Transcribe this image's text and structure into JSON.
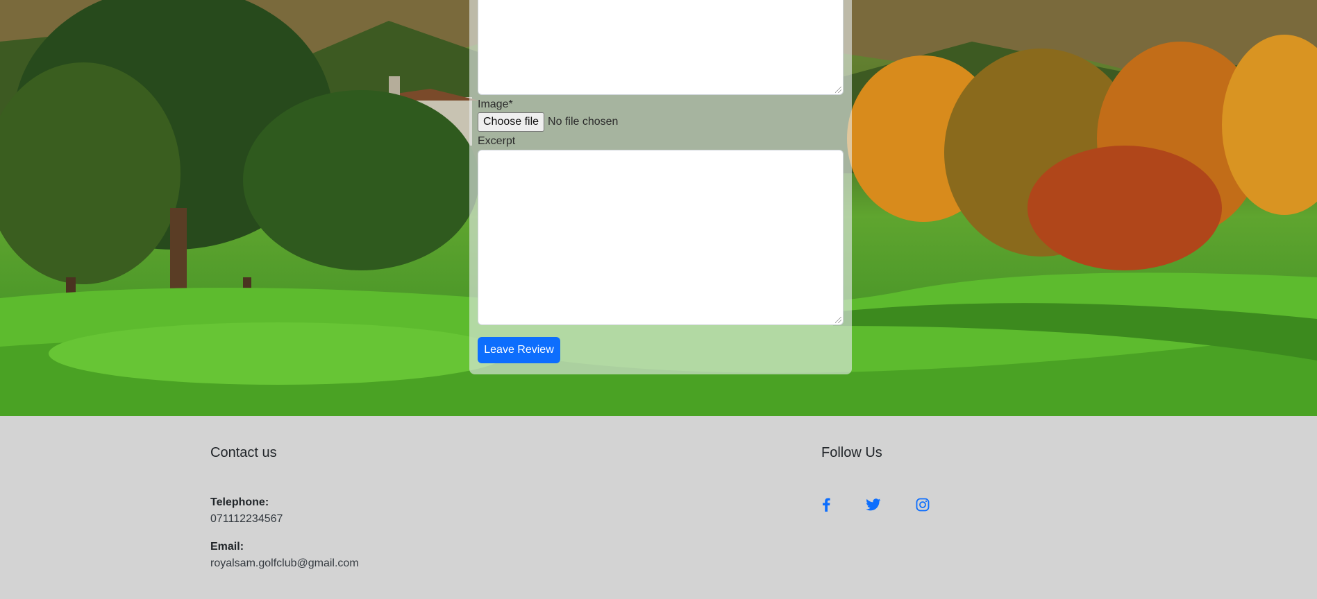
{
  "form": {
    "image_label": "Image*",
    "file_button_label": "Choose file",
    "file_status": "No file chosen",
    "excerpt_label": "Excerpt",
    "submit_label": "Leave Review"
  },
  "footer": {
    "contact": {
      "heading": "Contact us",
      "telephone_label": "Telephone:",
      "telephone_value": "071112234567",
      "email_label": "Email:",
      "email_value": "royalsam.golfclub@gmail.com"
    },
    "follow": {
      "heading": "Follow Us",
      "icons": [
        "facebook-icon",
        "twitter-icon",
        "instagram-icon"
      ]
    }
  },
  "colors": {
    "primary": "#0d6efd",
    "footer_bg": "#d3d3d3",
    "social_icon": "#0d6efd"
  }
}
